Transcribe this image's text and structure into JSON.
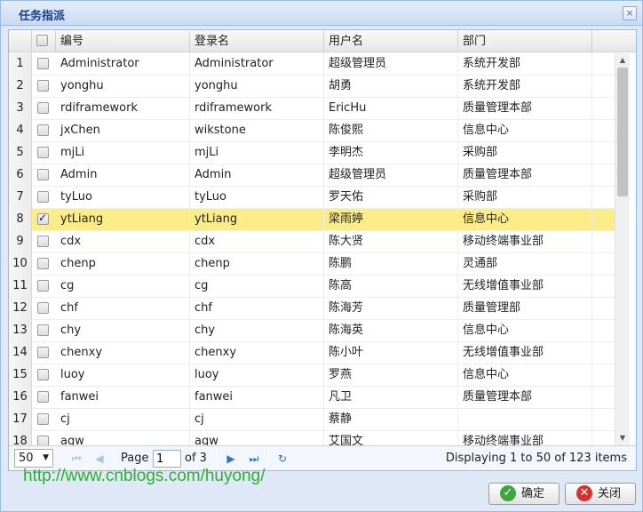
{
  "window": {
    "title": "任务指派",
    "close_glyph": "×"
  },
  "grid": {
    "columns": [
      "编号",
      "登录名",
      "用户名",
      "部门"
    ],
    "rows": [
      {
        "num": "1",
        "checked": false,
        "id": "Administrator",
        "login": "Administrator",
        "user": "超级管理员",
        "dept": "系统开发部"
      },
      {
        "num": "2",
        "checked": false,
        "id": "yonghu",
        "login": "yonghu",
        "user": "胡勇",
        "dept": "系统开发部"
      },
      {
        "num": "3",
        "checked": false,
        "id": "rdiframework",
        "login": "rdiframework",
        "user": "EricHu",
        "dept": "质量管理本部"
      },
      {
        "num": "4",
        "checked": false,
        "id": "jxChen",
        "login": "wikstone",
        "user": "陈俊熙",
        "dept": "信息中心"
      },
      {
        "num": "5",
        "checked": false,
        "id": "mjLi",
        "login": "mjLi",
        "user": "李明杰",
        "dept": "采购部"
      },
      {
        "num": "6",
        "checked": false,
        "id": "Admin",
        "login": "Admin",
        "user": "超级管理员",
        "dept": "质量管理本部"
      },
      {
        "num": "7",
        "checked": false,
        "id": "tyLuo",
        "login": "tyLuo",
        "user": "罗天佑",
        "dept": "采购部"
      },
      {
        "num": "8",
        "checked": true,
        "id": "ytLiang",
        "login": "ytLiang",
        "user": "梁雨婷",
        "dept": "信息中心"
      },
      {
        "num": "9",
        "checked": false,
        "id": "cdx",
        "login": "cdx",
        "user": "陈大贤",
        "dept": "移动终端事业部"
      },
      {
        "num": "10",
        "checked": false,
        "id": "chenp",
        "login": "chenp",
        "user": "陈鹏",
        "dept": "灵通部"
      },
      {
        "num": "11",
        "checked": false,
        "id": "cg",
        "login": "cg",
        "user": "陈高",
        "dept": "无线增值事业部"
      },
      {
        "num": "12",
        "checked": false,
        "id": "chf",
        "login": "chf",
        "user": "陈海芳",
        "dept": "质量管理部"
      },
      {
        "num": "13",
        "checked": false,
        "id": "chy",
        "login": "chy",
        "user": "陈海英",
        "dept": "信息中心"
      },
      {
        "num": "14",
        "checked": false,
        "id": "chenxy",
        "login": "chenxy",
        "user": "陈小叶",
        "dept": "无线增值事业部"
      },
      {
        "num": "15",
        "checked": false,
        "id": "luoy",
        "login": "luoy",
        "user": "罗燕",
        "dept": "信息中心"
      },
      {
        "num": "16",
        "checked": false,
        "id": "fanwei",
        "login": "fanwei",
        "user": "凡卫",
        "dept": "质量管理本部"
      },
      {
        "num": "17",
        "checked": false,
        "id": "cj",
        "login": "cj",
        "user": "蔡静",
        "dept": ""
      },
      {
        "num": "18",
        "checked": false,
        "id": "agw",
        "login": "agw",
        "user": "艾国文",
        "dept": "移动终端事业部"
      }
    ],
    "selected_row": "8"
  },
  "pager": {
    "page_size": "50",
    "page_label": "Page",
    "page_value": "1",
    "of_label": "of 3",
    "display_text": "Displaying 1 to 50 of 123 items"
  },
  "watermark": "http://www.cnblogs.com/huyong/",
  "buttons": {
    "ok": "确定",
    "close": "关闭"
  },
  "colors": {
    "selected_row": "#fbec88",
    "watermark": "#2fae2f",
    "title": "#15428b"
  }
}
